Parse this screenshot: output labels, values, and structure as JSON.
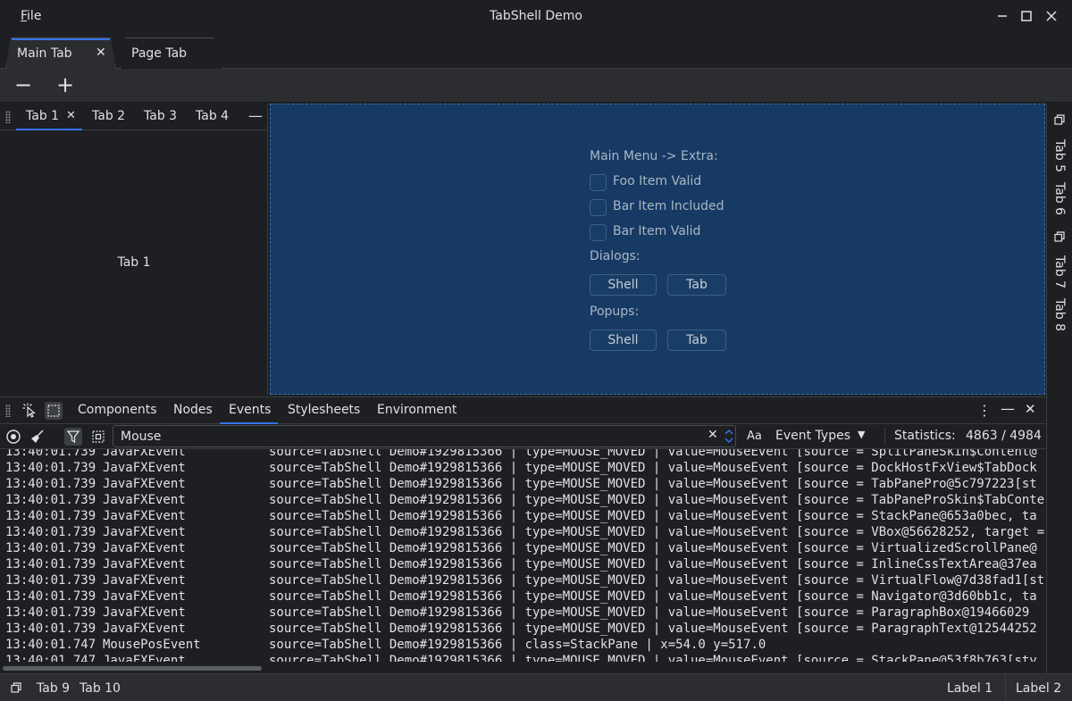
{
  "window": {
    "title": "TabShell Demo",
    "menu_file": "File"
  },
  "main_tabs": {
    "main": "Main Tab",
    "page": "Page Tab"
  },
  "toolbar": {
    "minus": "−",
    "plus": "+"
  },
  "left_dock": {
    "tabs": [
      "Tab 1",
      "Tab 2",
      "Tab 3",
      "Tab 4"
    ],
    "content": "Tab 1"
  },
  "center": {
    "main_menu_title": "Main Menu -> Extra:",
    "checkboxes": [
      "Foo Item Valid",
      "Bar Item Included",
      "Bar Item Valid"
    ],
    "dialogs_title": "Dialogs:",
    "dialog_buttons": [
      "Shell",
      "Tab"
    ],
    "popups_title": "Popups:",
    "popup_buttons": [
      "Shell",
      "Tab"
    ]
  },
  "right_strip": {
    "tabs": [
      "Tab 5",
      "Tab 6",
      "Tab 7",
      "Tab 8"
    ]
  },
  "inspector": {
    "tabs": [
      "Components",
      "Nodes",
      "Events",
      "Stylesheets",
      "Environment"
    ],
    "active_tab": "Events",
    "search_value": "Mouse",
    "match_case": "Aa",
    "event_types": "Event Types",
    "statistics_label": "Statistics:",
    "statistics_value": "4863 / 4984",
    "log": [
      {
        "time": "13:40:01.739",
        "type": "JavaFXEvent",
        "rest": "source=TabShell Demo#1929815366 | type=MOUSE_MOVED | value=MouseEvent [source = SplitPaneSkin$Content@"
      },
      {
        "time": "13:40:01.739",
        "type": "JavaFXEvent",
        "rest": "source=TabShell Demo#1929815366 | type=MOUSE_MOVED | value=MouseEvent [source = DockHostFxView$TabDock"
      },
      {
        "time": "13:40:01.739",
        "type": "JavaFXEvent",
        "rest": "source=TabShell Demo#1929815366 | type=MOUSE_MOVED | value=MouseEvent [source = TabPanePro@5c797223[st"
      },
      {
        "time": "13:40:01.739",
        "type": "JavaFXEvent",
        "rest": "source=TabShell Demo#1929815366 | type=MOUSE_MOVED | value=MouseEvent [source = TabPaneProSkin$TabConte"
      },
      {
        "time": "13:40:01.739",
        "type": "JavaFXEvent",
        "rest": "source=TabShell Demo#1929815366 | type=MOUSE_MOVED | value=MouseEvent [source = StackPane@653a0bec, ta"
      },
      {
        "time": "13:40:01.739",
        "type": "JavaFXEvent",
        "rest": "source=TabShell Demo#1929815366 | type=MOUSE_MOVED | value=MouseEvent [source = VBox@56628252, target ="
      },
      {
        "time": "13:40:01.739",
        "type": "JavaFXEvent",
        "rest": "source=TabShell Demo#1929815366 | type=MOUSE_MOVED | value=MouseEvent [source = VirtualizedScrollPane@"
      },
      {
        "time": "13:40:01.739",
        "type": "JavaFXEvent",
        "rest": "source=TabShell Demo#1929815366 | type=MOUSE_MOVED | value=MouseEvent [source = InlineCssTextArea@37ea"
      },
      {
        "time": "13:40:01.739",
        "type": "JavaFXEvent",
        "rest": "source=TabShell Demo#1929815366 | type=MOUSE_MOVED | value=MouseEvent [source = VirtualFlow@7d38fad1[st"
      },
      {
        "time": "13:40:01.739",
        "type": "JavaFXEvent",
        "rest": "source=TabShell Demo#1929815366 | type=MOUSE_MOVED | value=MouseEvent [source = Navigator@3d60bb1c, ta"
      },
      {
        "time": "13:40:01.739",
        "type": "JavaFXEvent",
        "rest": "source=TabShell Demo#1929815366 | type=MOUSE_MOVED | value=MouseEvent [source = ParagraphBox@19466029"
      },
      {
        "time": "13:40:01.739",
        "type": "JavaFXEvent",
        "rest": "source=TabShell Demo#1929815366 | type=MOUSE_MOVED | value=MouseEvent [source = ParagraphText@12544252"
      },
      {
        "time": "13:40:01.747",
        "type": "MousePosEvent",
        "rest": "source=TabShell Demo#1929815366 | class=StackPane | x=54.0 y=517.0"
      },
      {
        "time": "13:40:01.747",
        "type": "JavaFXEvent",
        "rest": "source=TabShell Demo#1929815366 | type=MOUSE_MOVED | value=MouseEvent [source = StackPane@53f8b763[sty"
      }
    ]
  },
  "status": {
    "tab9": "Tab 9",
    "tab10": "Tab 10",
    "label1": "Label 1",
    "label2": "Label 2"
  },
  "colors": {
    "background": "#1e1f22",
    "panel": "#2b2d30",
    "accent": "#3574f0",
    "center_pane": "#163a63"
  }
}
